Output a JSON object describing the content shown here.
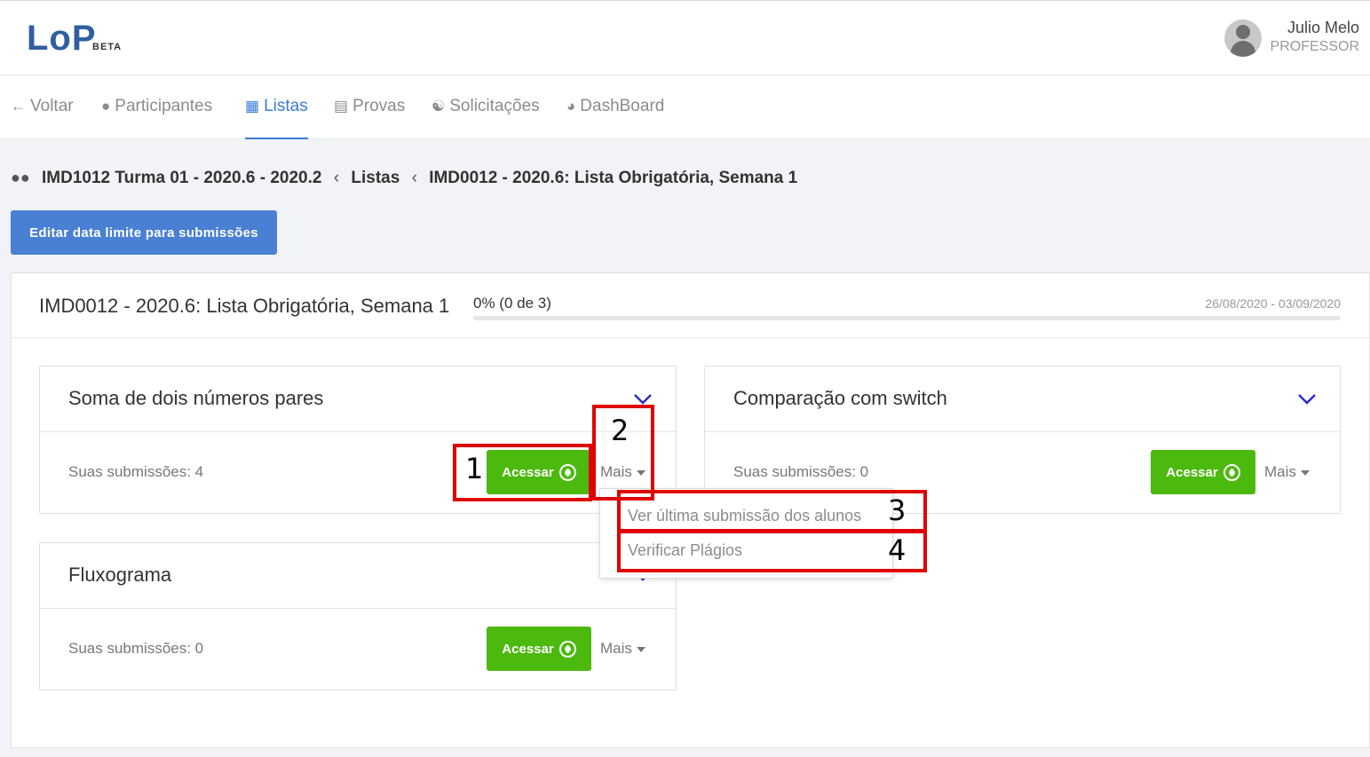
{
  "header": {
    "logo": "LoP",
    "logo_badge": "BETA",
    "user_name": "Julio Melo",
    "user_role": "PROFESSOR"
  },
  "nav": {
    "items": [
      {
        "label": "Voltar",
        "icon": "arrow-left-icon"
      },
      {
        "label": "Participantes",
        "icon": "users-icon"
      },
      {
        "label": "Listas",
        "icon": "file-icon",
        "active": true
      },
      {
        "label": "Provas",
        "icon": "document-icon"
      },
      {
        "label": "Solicitações",
        "icon": "user-group-icon"
      },
      {
        "label": "DashBoard",
        "icon": "pie-chart-icon"
      }
    ]
  },
  "breadcrumb": {
    "items": [
      "IMD1012 Turma 01 - 2020.6 - 2020.2",
      "Listas",
      "IMD0012 - 2020.6: Lista Obrigatória, Semana 1"
    ],
    "separator": "‹"
  },
  "edit_deadline_button": "Editar data limite para submissões",
  "panel": {
    "title": "IMD0012 - 2020.6: Lista Obrigatória, Semana 1",
    "progress_label": "0% (0 de 3)",
    "progress_value": 0,
    "date_range": "26/08/2020 - 03/09/2020"
  },
  "questions": [
    {
      "title": "Soma de dois números pares",
      "submissions": "Suas submissões: 4",
      "access_label": "Acessar",
      "more_label": "Mais"
    },
    {
      "title": "Comparação com switch",
      "submissions": "Suas submissões: 0",
      "access_label": "Acessar",
      "more_label": "Mais"
    },
    {
      "title": "Fluxograma",
      "submissions": "Suas submissões: 0",
      "access_label": "Acessar",
      "more_label": "Mais"
    }
  ],
  "dropdown": {
    "items": [
      "Ver última submissão dos alunos",
      "Verificar Plágios"
    ]
  },
  "annotations": [
    "1",
    "2",
    "3",
    "4"
  ],
  "colors": {
    "primary": "#4a80d4",
    "success": "#4cb90f",
    "annotation": "#e00000",
    "logo": "#2f5fa0"
  }
}
